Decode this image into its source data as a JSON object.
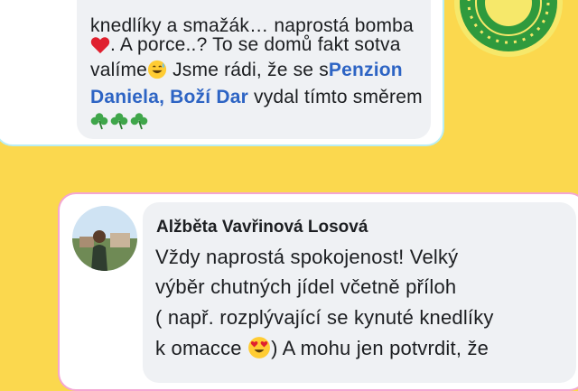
{
  "comment1": {
    "line1": "knedlíky a smažák… naprostá bomba",
    "line2": ". A porce..? To se domů fakt sotva",
    "line3_pre": "valíme",
    "line3_post": "  Jsme rádi, že se s",
    "line3_link": "Penzion",
    "line4_link": "Daniela, Boží Dar",
    "line4_post": " vydal tímto směrem"
  },
  "comment2": {
    "author": "Alžběta Vavřinová Losová",
    "line1": "Vždy naprostá spokojenost! Velký",
    "line2": "výběr chutných jídel včetně příloh",
    "line3": "( např. rozplývající se kynuté knedlíky",
    "line4_pre": "k omacce ",
    "line4_post": ") A mohu jen potvrdit, že"
  },
  "colors": {
    "background": "#fbd84e",
    "link": "#2d64c4",
    "card1_border": "#b9eef4",
    "card2_border": "#f4a6d2"
  },
  "icons": [
    "red-heart-icon",
    "grinning-sweat-face-icon",
    "shamrock-icon",
    "heart-eyes-face-icon",
    "decorative-badge-icon"
  ]
}
